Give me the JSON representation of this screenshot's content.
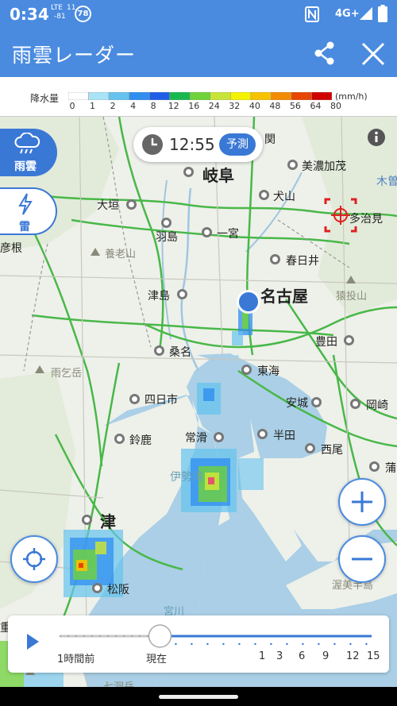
{
  "status_bar": {
    "time": "0:34",
    "lte_label": "LTE",
    "lte_signal_top": "11",
    "lte_signal_bottom": "-81",
    "badge": "78",
    "network": "4G+"
  },
  "app_bar": {
    "title": "雨雲レーダー",
    "share_icon": "share-icon",
    "close_icon": "close-icon"
  },
  "legend": {
    "label": "降水量",
    "unit": "(mm/h)",
    "ticks": [
      "0",
      "1",
      "2",
      "4",
      "8",
      "12",
      "16",
      "24",
      "32",
      "40",
      "48",
      "56",
      "64",
      "80"
    ],
    "colors": [
      "#ffffff",
      "#a9e3f7",
      "#65c3ee",
      "#2f8ef0",
      "#1f5ee6",
      "#18b850",
      "#6fd23a",
      "#c8e43a",
      "#f5f200",
      "#f7c200",
      "#f38b00",
      "#e84600",
      "#cf0000",
      "#9a0020"
    ]
  },
  "time_pill": {
    "time": "12:55",
    "badge": "予測"
  },
  "side_buttons": {
    "rain_label": "雨雲",
    "thunder_label": "雷"
  },
  "map": {
    "cities": {
      "gifu": "岐阜",
      "minokamo": "美濃加茂",
      "kiso": "木曽",
      "ogaki": "大垣",
      "inuyama": "犬山",
      "tajimi": "多治見",
      "hikone": "彦根",
      "hashima": "羽島",
      "ichinomiya": "一宮",
      "kasugai": "春日井",
      "tsushima": "津島",
      "nagoya": "名古屋",
      "toyota": "豊田",
      "kuwana": "桑名",
      "tokai": "東海",
      "yokkaichi": "四日市",
      "anjo": "安城",
      "okazaki": "岡崎",
      "suzuka": "鈴鹿",
      "tokoname": "常滑",
      "handa": "半田",
      "nishio": "西尾",
      "gamagori": "蒲",
      "tsu": "津",
      "matsusaka": "松阪",
      "shima": "重県"
    },
    "terrain": {
      "yoro": "養老山",
      "sanage": "猿投山",
      "amago": "雨乞岳",
      "ise_bay": "伊勢湾",
      "miyagawa": "宮川",
      "atsumi": "渥美半島",
      "nanase": "七洞岳",
      "seki": "関"
    }
  },
  "timeline": {
    "labels": [
      "1時間前",
      "現在",
      "1",
      "3",
      "6",
      "9",
      "12",
      "15"
    ],
    "position_fraction": 0.32
  },
  "zoom": {
    "in_icon": "plus-icon",
    "out_icon": "minus-icon"
  }
}
